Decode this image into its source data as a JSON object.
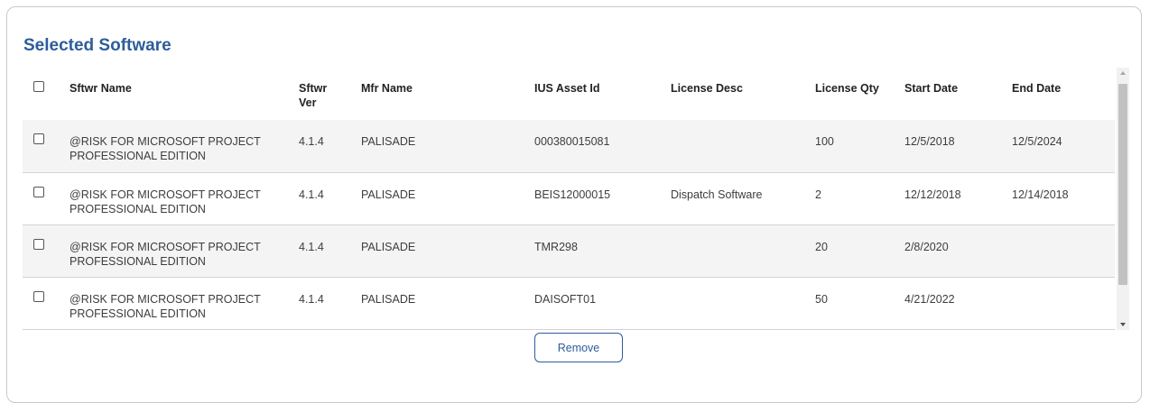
{
  "section": {
    "title": "Selected Software"
  },
  "table": {
    "headers": {
      "name": "Sftwr Name",
      "ver": "Sftwr Ver",
      "mfr": "Mfr Name",
      "ius": "IUS Asset Id",
      "desc": "License Desc",
      "qty": "License Qty",
      "start": "Start Date",
      "end": "End Date"
    },
    "rows": [
      {
        "name": "@RISK FOR MICROSOFT PROJECT PROFESSIONAL EDITION",
        "ver": "4.1.4",
        "mfr": "PALISADE",
        "ius": "000380015081",
        "desc": "",
        "qty": "100",
        "start": "12/5/2018",
        "end": "12/5/2024"
      },
      {
        "name": "@RISK FOR MICROSOFT PROJECT PROFESSIONAL EDITION",
        "ver": "4.1.4",
        "mfr": "PALISADE",
        "ius": "BEIS12000015",
        "desc": "Dispatch Software",
        "qty": "2",
        "start": "12/12/2018",
        "end": "12/14/2018"
      },
      {
        "name": "@RISK FOR MICROSOFT PROJECT PROFESSIONAL EDITION",
        "ver": "4.1.4",
        "mfr": "PALISADE",
        "ius": "TMR298",
        "desc": "",
        "qty": "20",
        "start": "2/8/2020",
        "end": ""
      },
      {
        "name": "@RISK FOR MICROSOFT PROJECT PROFESSIONAL EDITION",
        "ver": "4.1.4",
        "mfr": "PALISADE",
        "ius": "DAISOFT01",
        "desc": "",
        "qty": "50",
        "start": "4/21/2022",
        "end": ""
      }
    ]
  },
  "actions": {
    "remove_label": "Remove"
  }
}
